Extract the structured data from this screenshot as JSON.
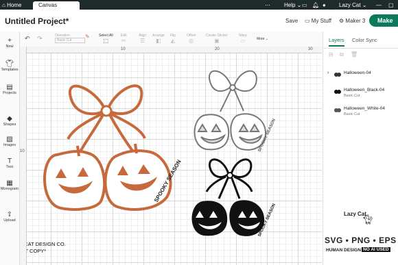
{
  "topbar": {
    "home": "Home",
    "canvas": "Canvas",
    "help": "Help",
    "user": "Lazy Cat"
  },
  "project": {
    "title": "Untitled Project*",
    "save": "Save",
    "my_stuff": "My Stuff",
    "machine": "Maker 3",
    "make": "Make"
  },
  "toolbar": {
    "items": [
      "Operation",
      "Select All",
      "Edit",
      "Align",
      "Arrange",
      "Flip",
      "Offset",
      "Create Sticker",
      "Warp",
      "More"
    ],
    "operation_value": "Basic Cut"
  },
  "leftrail": [
    "New",
    "Templates",
    "Projects",
    "Shapes",
    "Images",
    "Text",
    "Monogram",
    "Upload"
  ],
  "ruler": {
    "top_marks": [
      "10",
      "20",
      "30"
    ],
    "left_marks": [
      "10"
    ]
  },
  "panel": {
    "tabs": [
      "Layers",
      "Color Sync"
    ],
    "layers": [
      {
        "name": "Halloween-04",
        "sub": ""
      },
      {
        "name": "Halloween_Black-04",
        "sub": "Basic Cut"
      },
      {
        "name": "Halloween_White-04",
        "sub": "Basic Cut"
      }
    ]
  },
  "artwork": {
    "ribbon_text": "SPOOKY SEASON"
  },
  "watermark": {
    "copyright": "©LAZY CAT DESIGN CO.",
    "do_not_copy": "*DO NOT COPY*",
    "brand": "Lazy Cat",
    "formats": "SVG • PNG • EPS",
    "human": "HUMAN DESIGN",
    "no_ai": "NO AI USED"
  },
  "colors": {
    "accent": "#0b7a5b",
    "topbar": "#1f2b2b",
    "pumpkin": "#c66a3e"
  }
}
